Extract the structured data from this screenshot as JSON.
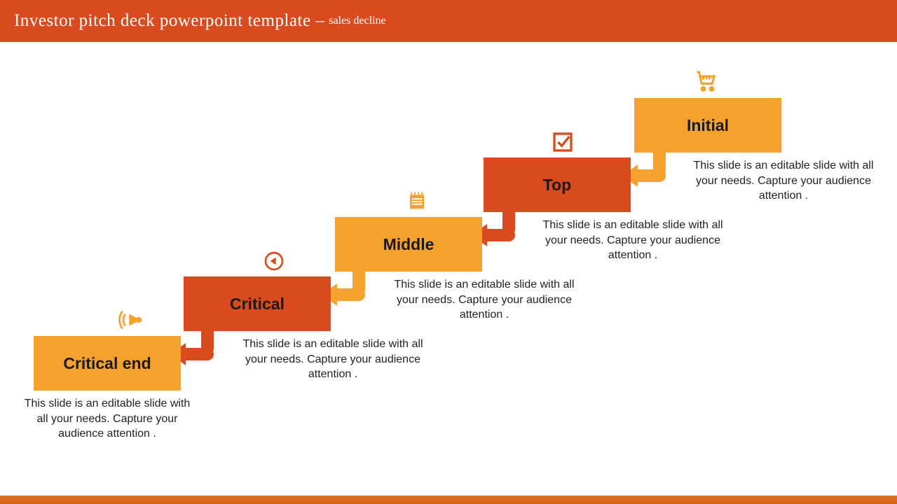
{
  "header": {
    "title_main": "Investor pitch deck powerpoint template – ",
    "title_sub": "sales decline"
  },
  "colors": {
    "accent_dark": "#d94a1f",
    "accent_light": "#f6a02e"
  },
  "steps": [
    {
      "label": "Initial",
      "desc": "This slide is an editable slide with all your needs. Capture your audience attention .",
      "icon": "cart-icon",
      "tone": "light"
    },
    {
      "label": "Top",
      "desc": "This slide is an editable slide with all your needs. Capture your audience attention .",
      "icon": "check-icon",
      "tone": "dark"
    },
    {
      "label": "Middle",
      "desc": "This slide is an editable slide with all your needs. Capture your audience attention .",
      "icon": "notepad-icon",
      "tone": "light"
    },
    {
      "label": "Critical",
      "desc": "This slide is an editable slide with all your needs. Capture your audience attention .",
      "icon": "play-icon",
      "tone": "dark"
    },
    {
      "label": "Critical end",
      "desc": "This slide is an editable slide with all your needs. Capture your audience attention .",
      "icon": "speaker-icon",
      "tone": "light"
    }
  ]
}
